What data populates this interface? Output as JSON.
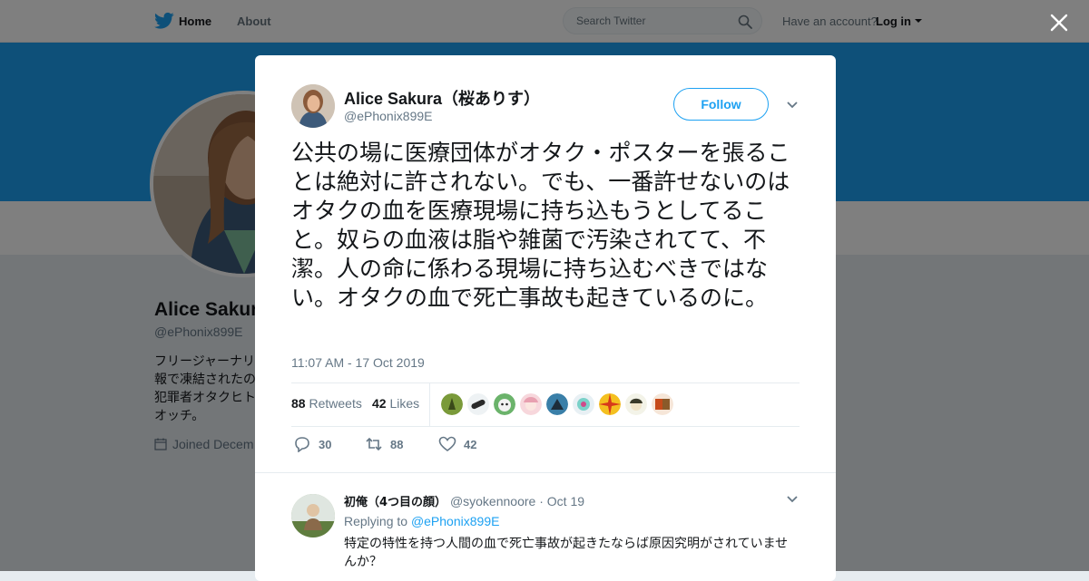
{
  "nav": {
    "home_label": "Home",
    "about_label": "About",
    "search_placeholder": "Search Twitter",
    "account_prompt": "Have an account?",
    "login_label": "Log in",
    "brand_color": "#1da1f2"
  },
  "profile": {
    "name": "Alice Sakur",
    "handle": "@ePhonix899E",
    "bio": "フリージャーナリ\n報で凍結されたの\n犯罪者オタクヒト\nオッチ。",
    "joined": "Joined Decem",
    "banner_color": "#1da1f2"
  },
  "tweet": {
    "author_name": "Alice Sakura（桜ありす）",
    "author_handle": "@ePhonix899E",
    "follow_label": "Follow",
    "text": "公共の場に医療団体がオタク・ポスターを張ることは絶対に許されない。でも、一番許せないのはオタクの血を医療現場に持ち込もうとしてること。奴らの血液は脂や雑菌で汚染されてて、不潔。人の命に係わる現場に持ち込むべきではない。オタクの血で死亡事故も起きているのに。",
    "timestamp": "11:07 AM - 17 Oct 2019",
    "retweets_count": "88",
    "retweets_label": "Retweets",
    "likes_count": "42",
    "likes_label": "Likes",
    "reply_action_count": "30",
    "retweet_action_count": "88",
    "like_action_count": "42"
  },
  "reply": {
    "author_name": "初俺（4つ目の顔）",
    "author_handle": "@syokennoore",
    "date": "· Oct 19",
    "replying_label": "Replying to",
    "replying_to": "@ePhonix899E",
    "text": "特定の特性を持つ人間の血で死亡事故が起きたならば原因究明がされていませんか？"
  }
}
